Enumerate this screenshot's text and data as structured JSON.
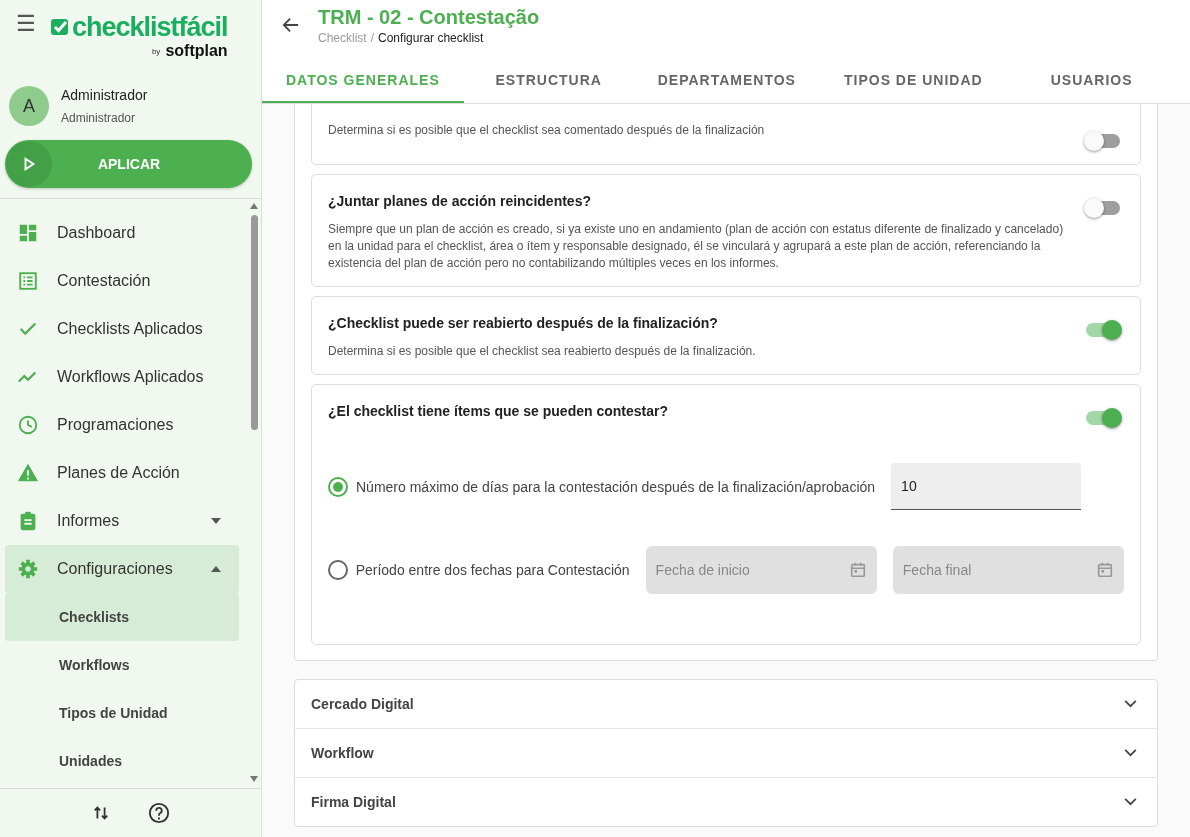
{
  "sidebar": {
    "menu_icon": "☰",
    "logo": {
      "name": "checklistfácil",
      "by": "by",
      "brand": "softplan"
    },
    "user": {
      "initial": "A",
      "name": "Administrador",
      "role": "Administrador"
    },
    "apply_button": "APLICAR",
    "items": [
      {
        "label": "Dashboard",
        "selected": false
      },
      {
        "label": "Contestación",
        "selected": false
      },
      {
        "label": "Checklists Aplicados",
        "selected": false
      },
      {
        "label": "Workflows Aplicados",
        "selected": false
      },
      {
        "label": "Programaciones",
        "selected": false
      },
      {
        "label": "Planes de Acción",
        "selected": false
      },
      {
        "label": "Informes",
        "selected": false,
        "expanded": false
      },
      {
        "label": "Configuraciones",
        "selected": true,
        "expanded": true,
        "children": [
          {
            "label": "Checklists",
            "selected": true
          },
          {
            "label": "Workflows",
            "selected": false
          },
          {
            "label": "Tipos de Unidad",
            "selected": false
          },
          {
            "label": "Unidades",
            "selected": false
          }
        ]
      }
    ]
  },
  "header": {
    "title": "TRM - 02 - Contestação",
    "breadcrumb": [
      "Checklist",
      "Configurar checklist"
    ],
    "separator": "/"
  },
  "tabs": [
    {
      "label": "DATOS GENERALES",
      "selected": true
    },
    {
      "label": "ESTRUCTURA",
      "selected": false
    },
    {
      "label": "DEPARTAMENTOS",
      "selected": false
    },
    {
      "label": "TIPOS DE UNIDAD",
      "selected": false
    },
    {
      "label": "USUARIOS",
      "selected": false
    }
  ],
  "settings": [
    {
      "description": "Determina si es posible que el checklist sea comentado después de la finalización",
      "on": false
    },
    {
      "title": "¿Juntar planes de acción reincidentes?",
      "description": "Siempre que un plan de acción es creado, si ya existe uno en andamiento (plan de acción con estatus diferente de finalizado y cancelado) en la unidad para el checklist, área o ítem y responsable designado, él se vinculará y agrupará a este plan de acción, referenciando la existencia del plan de acción pero no contabilizando múltiples veces en los informes.",
      "on": false
    },
    {
      "title": "¿Checklist puede ser reabierto después de la finalización?",
      "description": "Determina si es posible que el checklist sea reabierto después de la finalización.",
      "on": true
    },
    {
      "title": "¿El checklist tiene ítems que se pueden contestar?",
      "on": true,
      "options": [
        {
          "label": "Número máximo de días para la contestación después de la finalización/aprobación",
          "selected": true,
          "kind": "number",
          "value": "10"
        },
        {
          "label": "Período entre dos fechas para Contestación",
          "selected": false,
          "kind": "dates",
          "fields": [
            {
              "placeholder": "Fecha de inicio"
            },
            {
              "placeholder": "Fecha final"
            }
          ]
        }
      ]
    }
  ],
  "sections": [
    {
      "title": "Cercado Digital",
      "expanded": false
    },
    {
      "title": "Workflow",
      "expanded": false
    },
    {
      "title": "Firma Digital",
      "expanded": false
    }
  ]
}
